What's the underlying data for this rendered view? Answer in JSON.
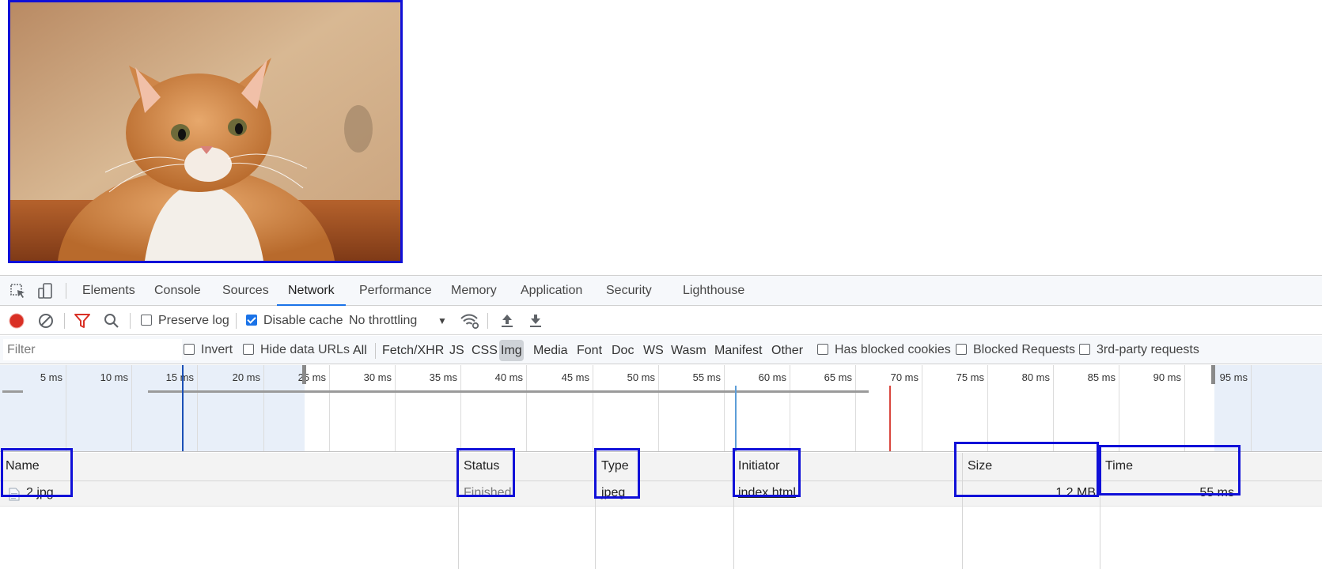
{
  "page": {
    "image_alt": "orange and white cat looking up"
  },
  "devtools": {
    "tabs": [
      "Elements",
      "Console",
      "Sources",
      "Network",
      "Performance",
      "Memory",
      "Application",
      "Security",
      "Lighthouse"
    ],
    "active_tab": "Network",
    "toolbar": {
      "preserve_log": "Preserve log",
      "preserve_log_checked": false,
      "disable_cache": "Disable cache",
      "disable_cache_checked": true,
      "throttling": "No throttling"
    },
    "filterbar": {
      "filter_placeholder": "Filter",
      "invert": "Invert",
      "hide_data_urls": "Hide data URLs",
      "types": [
        "All",
        "Fetch/XHR",
        "JS",
        "CSS",
        "Img",
        "Media",
        "Font",
        "Doc",
        "WS",
        "Wasm",
        "Manifest",
        "Other"
      ],
      "active_type": "Img",
      "has_blocked_cookies": "Has blocked cookies",
      "blocked_requests": "Blocked Requests",
      "third_party": "3rd-party requests"
    },
    "overview": {
      "ticks": [
        "5 ms",
        "10 ms",
        "15 ms",
        "20 ms",
        "25 ms",
        "30 ms",
        "35 ms",
        "40 ms",
        "45 ms",
        "50 ms",
        "55 ms",
        "60 ms",
        "65 ms",
        "70 ms",
        "75 ms",
        "80 ms",
        "85 ms",
        "90 ms",
        "95 ms"
      ]
    },
    "table": {
      "headers": {
        "name": "Name",
        "status": "Status",
        "type": "Type",
        "initiator": "Initiator",
        "size": "Size",
        "time": "Time"
      },
      "rows": [
        {
          "name": "2.jpg",
          "status": "Finished",
          "type": "jpeg",
          "initiator": "index.html",
          "size": "1.2 MB",
          "time": "55 ms"
        }
      ]
    }
  }
}
